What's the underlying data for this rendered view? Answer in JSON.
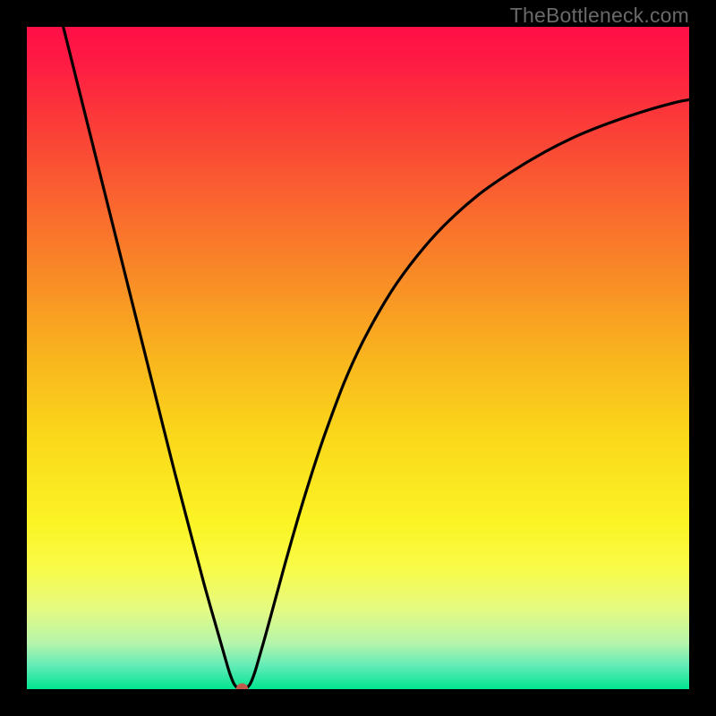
{
  "watermark": "TheBottleneck.com",
  "chart_data": {
    "type": "line",
    "title": "",
    "xlabel": "",
    "ylabel": "",
    "xlim": [
      0,
      100
    ],
    "ylim": [
      0,
      100
    ],
    "background": {
      "type": "vertical_gradient",
      "stops": [
        {
          "pos": 0.0,
          "color": "#ff0f46"
        },
        {
          "pos": 0.05,
          "color": "#ff1a44"
        },
        {
          "pos": 0.14,
          "color": "#fb3a39"
        },
        {
          "pos": 0.25,
          "color": "#fa6030"
        },
        {
          "pos": 0.38,
          "color": "#f98c26"
        },
        {
          "pos": 0.5,
          "color": "#f9b51e"
        },
        {
          "pos": 0.62,
          "color": "#fad81a"
        },
        {
          "pos": 0.75,
          "color": "#fbf425"
        },
        {
          "pos": 0.82,
          "color": "#f8fb4a"
        },
        {
          "pos": 0.88,
          "color": "#e4fa82"
        },
        {
          "pos": 0.93,
          "color": "#b6f5aa"
        },
        {
          "pos": 0.965,
          "color": "#62ebb7"
        },
        {
          "pos": 1.0,
          "color": "#00e58e"
        }
      ]
    },
    "series": [
      {
        "name": "bottleneck-curve",
        "stroke": "#000000",
        "points": [
          {
            "x": 5.5,
            "y": 100
          },
          {
            "x": 7.0,
            "y": 94
          },
          {
            "x": 10.0,
            "y": 82
          },
          {
            "x": 13.0,
            "y": 70
          },
          {
            "x": 16.0,
            "y": 58
          },
          {
            "x": 19.0,
            "y": 46
          },
          {
            "x": 22.0,
            "y": 34
          },
          {
            "x": 25.0,
            "y": 22.5
          },
          {
            "x": 27.0,
            "y": 15
          },
          {
            "x": 29.0,
            "y": 8
          },
          {
            "x": 30.0,
            "y": 4.5
          },
          {
            "x": 30.5,
            "y": 2.8
          },
          {
            "x": 31.0,
            "y": 1.4
          },
          {
            "x": 31.4,
            "y": 0.6
          },
          {
            "x": 31.9,
            "y": 0.15
          },
          {
            "x": 32.5,
            "y": 0.0
          },
          {
            "x": 33.1,
            "y": 0.15
          },
          {
            "x": 33.6,
            "y": 0.6
          },
          {
            "x": 34.0,
            "y": 1.4
          },
          {
            "x": 34.5,
            "y": 2.8
          },
          {
            "x": 35.0,
            "y": 4.5
          },
          {
            "x": 36.0,
            "y": 8.0
          },
          {
            "x": 37.5,
            "y": 13.5
          },
          {
            "x": 39.0,
            "y": 19.0
          },
          {
            "x": 41.0,
            "y": 26.0
          },
          {
            "x": 43.0,
            "y": 32.5
          },
          {
            "x": 45.0,
            "y": 38.5
          },
          {
            "x": 48.0,
            "y": 46.5
          },
          {
            "x": 51.0,
            "y": 53.0
          },
          {
            "x": 55.0,
            "y": 60.0
          },
          {
            "x": 59.0,
            "y": 65.5
          },
          {
            "x": 63.0,
            "y": 70.0
          },
          {
            "x": 68.0,
            "y": 74.5
          },
          {
            "x": 73.0,
            "y": 78.0
          },
          {
            "x": 78.0,
            "y": 81.0
          },
          {
            "x": 83.0,
            "y": 83.5
          },
          {
            "x": 88.0,
            "y": 85.5
          },
          {
            "x": 93.0,
            "y": 87.2
          },
          {
            "x": 98.0,
            "y": 88.6
          },
          {
            "x": 100.0,
            "y": 89.0
          }
        ]
      }
    ],
    "marker": {
      "x": 32.5,
      "y": 0.0,
      "color": "#c15a4a",
      "radius_pct": 0.9
    }
  }
}
